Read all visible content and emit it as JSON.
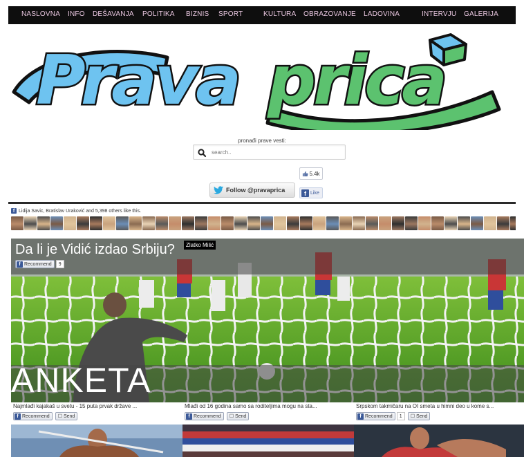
{
  "nav": {
    "items": [
      "NASLOVNA",
      "INFO",
      "DEŠAVANJA",
      "POLITIKA",
      "BIZNIS",
      "SPORT",
      "KULTURA",
      "OBRAZOVANJE",
      "LADOVINA",
      "INTERVJU",
      "GALERIJA"
    ]
  },
  "logo": {
    "part1": "Prava",
    "part2": "prica",
    "color1": "#6ec3f0",
    "color2": "#5cc26f"
  },
  "search": {
    "caption": "pronađi prave vesti:",
    "placeholder": "search.."
  },
  "social": {
    "like_count": "5.4k",
    "follow_label": "Follow @pravaprica",
    "like_label": "Like"
  },
  "facepile": {
    "text": "Lidija Savic, Bratislav Uraković and 5,398 others like this."
  },
  "hero": {
    "title": "Da li je Vidić izdao Srbiju?",
    "author": "Zlatko Milić",
    "recommend_label": "Recommend",
    "recommend_count": "9",
    "banner": "ANKETA"
  },
  "cards": [
    {
      "caption": "Najmlađi kajakaš u svetu - 15 puta prvak države ...",
      "recommend_label": "Recommend",
      "send_label": "Send",
      "count": ""
    },
    {
      "caption": "Mlađi od 16 godina samo sa roditeljima mogu na sta...",
      "recommend_label": "Recommend",
      "send_label": "Send",
      "count": ""
    },
    {
      "caption": "Srpskom takmičaru na OI smeta u himni deo u kome s...",
      "recommend_label": "Recommend",
      "send_label": "Send",
      "count": "1"
    }
  ]
}
